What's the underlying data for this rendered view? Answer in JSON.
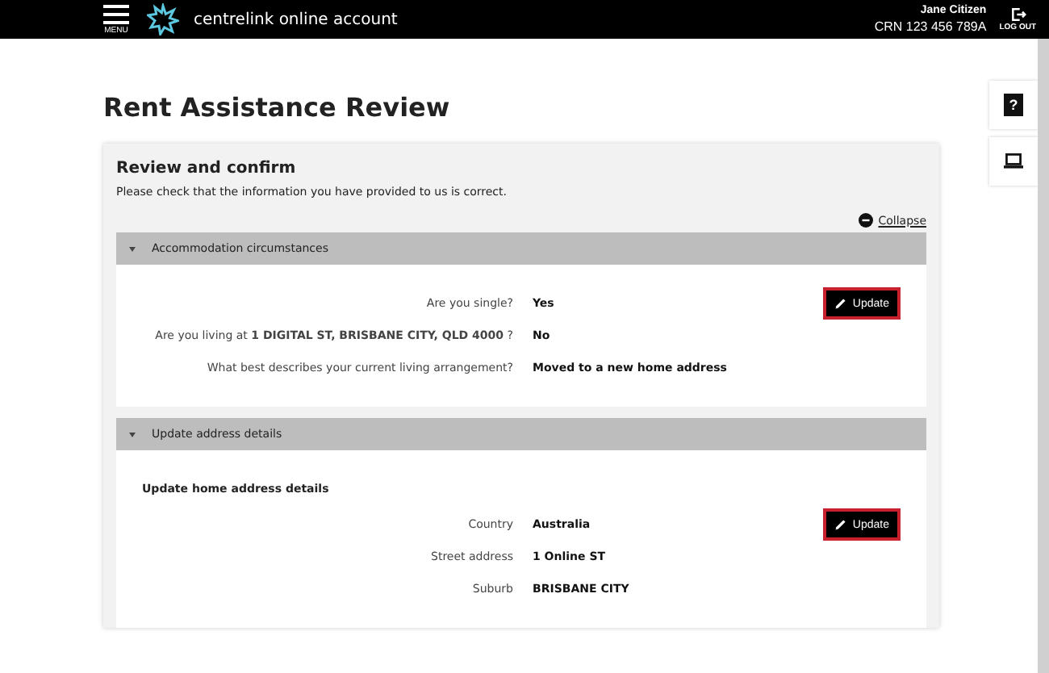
{
  "header": {
    "menu_label": "MENU",
    "brand": "centrelink online account",
    "user_name": "Jane Citizen",
    "crn": "CRN 123 456 789A",
    "logout_label": "LOG OUT"
  },
  "page_title": "Rent Assistance Review",
  "card": {
    "title": "Review and confirm",
    "intro": "Please check that the information you have provided to us is correct.",
    "collapse_label": "Collapse",
    "sections": [
      {
        "title": "Accommodation circumstances",
        "expanded": true,
        "button": "Update",
        "rows": [
          {
            "label": "Are you single?",
            "value": "Yes"
          },
          {
            "label": "Are you living at **1 DIGITAL ST, BRISBANE CITY, QLD 4000** ?",
            "value": "No"
          },
          {
            "label": "What best describes your current living arrangement?",
            "value": "Moved to a new home address"
          }
        ]
      },
      {
        "title": "Update address details",
        "expanded": true,
        "subheading": "Update home address details",
        "button": "Update",
        "rows": [
          {
            "label": "Country",
            "value": "Australia"
          },
          {
            "label": "Street address",
            "value": "1 Online ST"
          },
          {
            "label": "Suburb",
            "value": "BRISBANE CITY"
          }
        ]
      }
    ]
  },
  "side_tools": [
    {
      "kind": "help",
      "label": "?"
    },
    {
      "kind": "computer"
    }
  ]
}
